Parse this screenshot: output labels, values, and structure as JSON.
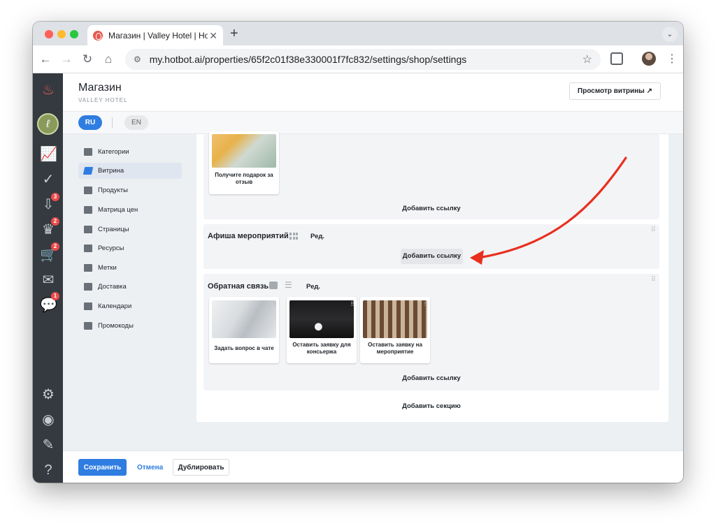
{
  "browser": {
    "tab_title": "Магазин | Valley Hotel | Hotbot",
    "url": "my.hotbot.ai/properties/65f2c01f38e330001f7fc832/settings/shop/settings"
  },
  "header": {
    "title": "Магазин",
    "subtitle": "VALLEY HOTEL",
    "preview_label": "Просмотр витрины ↗"
  },
  "languages": {
    "ru": "RU",
    "en": "EN"
  },
  "rail_badges": {
    "inbox": "3",
    "orders": "2",
    "cart": "2",
    "chat": "1"
  },
  "sidebar": {
    "items": [
      {
        "label": "Категории"
      },
      {
        "label": "Витрина"
      },
      {
        "label": "Продукты"
      },
      {
        "label": "Матрица цен"
      },
      {
        "label": "Страницы"
      },
      {
        "label": "Ресурсы"
      },
      {
        "label": "Метки"
      },
      {
        "label": "Доставка"
      },
      {
        "label": "Календари"
      },
      {
        "label": "Промокоды"
      }
    ]
  },
  "sections": {
    "top": {
      "card_label": "Получите подарок за отзыв",
      "add_link": "Добавить ссылку"
    },
    "events": {
      "title": "Афиша мероприятий",
      "edit": "Ред.",
      "add_link": "Добавить ссылку"
    },
    "feedback": {
      "title": "Обратная связь",
      "edit": "Ред.",
      "cards": [
        {
          "label": "Задать вопрос в чате"
        },
        {
          "label": "Оставить заявку для консьержа"
        },
        {
          "label": "Оставить заявку на мероприятие"
        }
      ],
      "add_link": "Добавить ссылку"
    },
    "add_section": "Добавить секцию"
  },
  "footer": {
    "save": "Сохранить",
    "cancel": "Отмена",
    "duplicate": "Дублировать"
  },
  "colors": {
    "accent": "#2f7de1",
    "rail": "#353a40",
    "annotation_arrow": "#e8301f"
  }
}
